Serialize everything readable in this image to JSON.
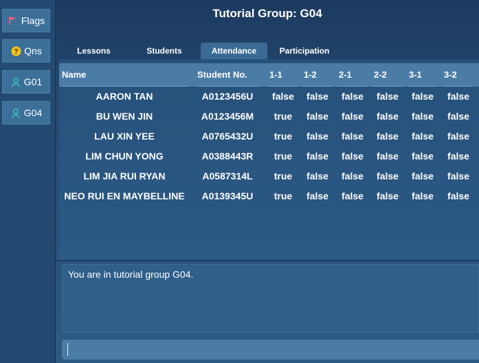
{
  "sidebar": {
    "items": [
      {
        "label": "Flags",
        "icon": "flag-icon"
      },
      {
        "label": "Qns",
        "icon": "question-icon"
      },
      {
        "label": "G01",
        "icon": "person-icon"
      },
      {
        "label": "G04",
        "icon": "person-icon"
      }
    ]
  },
  "header": {
    "title": "Tutorial Group: G04"
  },
  "tabs": [
    {
      "label": "Lessons"
    },
    {
      "label": "Students"
    },
    {
      "label": "Attendance",
      "active": true
    },
    {
      "label": "Participation"
    }
  ],
  "table": {
    "columns": [
      "Name",
      "Student No.",
      "1-1",
      "1-2",
      "2-1",
      "2-2",
      "3-1",
      "3-2"
    ],
    "rows": [
      [
        "AARON TAN",
        "A0123456U",
        "false",
        "false",
        "false",
        "false",
        "false",
        "false"
      ],
      [
        "BU WEN JIN",
        "A0123456M",
        "true",
        "false",
        "false",
        "false",
        "false",
        "false"
      ],
      [
        "LAU XIN YEE",
        "A0765432U",
        "true",
        "false",
        "false",
        "false",
        "false",
        "false"
      ],
      [
        "LIM CHUN YONG",
        "A0388443R",
        "true",
        "false",
        "false",
        "false",
        "false",
        "false"
      ],
      [
        "LIM JIA RUI RYAN",
        "A0587314L",
        "true",
        "false",
        "false",
        "false",
        "false",
        "false"
      ],
      [
        "NEO RUI EN MAYBELLINE",
        "A0139345U",
        "true",
        "false",
        "false",
        "false",
        "false",
        "false"
      ]
    ]
  },
  "output": {
    "text": "You are in tutorial group G04."
  },
  "command": {
    "value": ""
  },
  "colors": {
    "flag": "#e8607a",
    "question": "#f5c518",
    "person": "#3fc4c0"
  }
}
